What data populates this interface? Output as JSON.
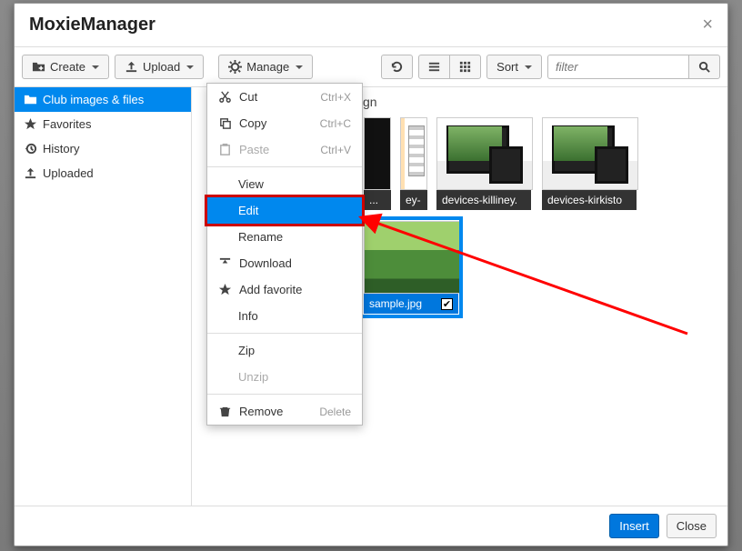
{
  "header": {
    "title": "MoxieManager"
  },
  "toolbar": {
    "create": "Create",
    "upload": "Upload",
    "manage": "Manage",
    "sort": "Sort",
    "filter_placeholder": "filter"
  },
  "sidebar": {
    "items": [
      {
        "label": "Club images & files"
      },
      {
        "label": "Favorites"
      },
      {
        "label": "History"
      },
      {
        "label": "Uploaded"
      }
    ]
  },
  "breadcrumb": {
    "trailing": "gn"
  },
  "thumbs": [
    {
      "label": "...",
      "selected": false
    },
    {
      "label": "ey-",
      "selected": false
    },
    {
      "label": "devices-killiney.",
      "selected": false
    },
    {
      "label": "devices-kirkisto",
      "selected": false
    },
    {
      "label": "sample.jpg",
      "selected": true
    }
  ],
  "menu": {
    "cut": {
      "label": "Cut",
      "shortcut": "Ctrl+X"
    },
    "copy": {
      "label": "Copy",
      "shortcut": "Ctrl+C"
    },
    "paste": {
      "label": "Paste",
      "shortcut": "Ctrl+V"
    },
    "view": "View",
    "edit": "Edit",
    "rename": "Rename",
    "download": "Download",
    "favorite": "Add favorite",
    "info": "Info",
    "zip": "Zip",
    "unzip": "Unzip",
    "remove": "Remove",
    "delete": "Delete"
  },
  "footer": {
    "insert": "Insert",
    "close": "Close"
  }
}
